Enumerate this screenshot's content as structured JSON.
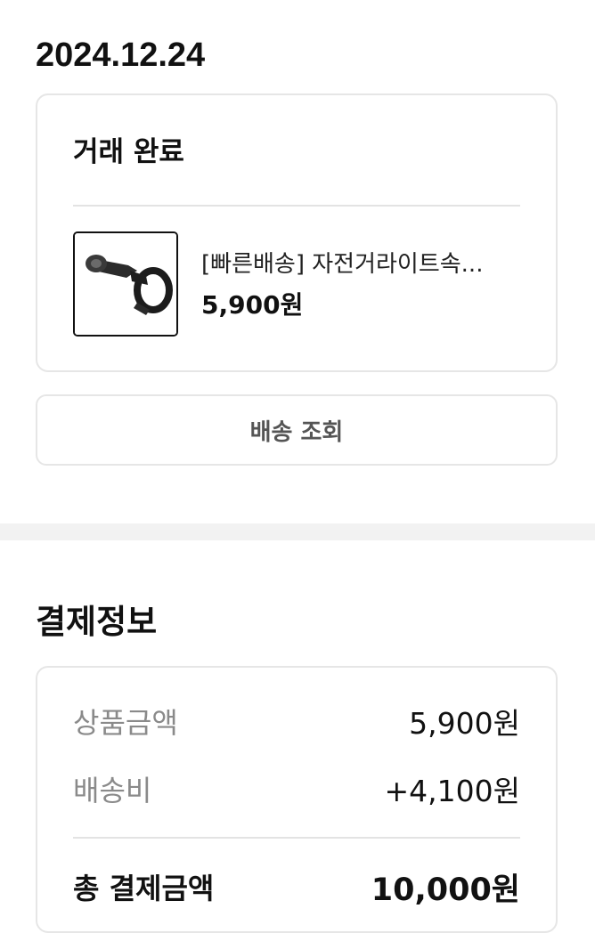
{
  "order": {
    "date": "2024.12.24",
    "status": "거래 완료",
    "product": {
      "name": "[빠른배송] 자전거라이트속...",
      "price": "5,900원",
      "image_icon": "bike-mount-icon"
    },
    "track_button_label": "배송 조회"
  },
  "payment": {
    "section_title": "결제정보",
    "rows": [
      {
        "label": "상품금액",
        "value": "5,900원"
      },
      {
        "label": "배송비",
        "value": "+4,100원"
      }
    ],
    "total": {
      "label": "총 결제금액",
      "value": "10,000원"
    }
  },
  "colors": {
    "text_primary": "#111111",
    "text_muted": "#8a8a8a",
    "border": "#e6e6e6",
    "section_gap": "#f2f2f2"
  }
}
